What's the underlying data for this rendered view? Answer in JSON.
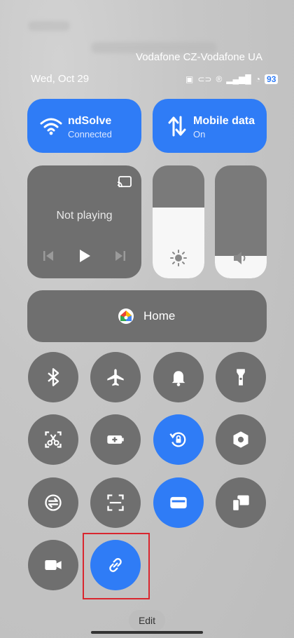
{
  "status_bar": {
    "carrier": "Vodafone CZ-Vodafone UA",
    "date": "Wed, Oct 29",
    "battery": "93"
  },
  "wifi_tile": {
    "title": "ndSolve",
    "subtitle": "Connected"
  },
  "mobile_tile": {
    "title": "Mobile data",
    "subtitle": "On"
  },
  "media": {
    "status": "Not playing"
  },
  "sliders": {
    "brightness_level": 0.63,
    "volume_level": 0.2
  },
  "home_tile": {
    "label": "Home"
  },
  "toggles": [
    {
      "icon": "bluetooth-icon",
      "active": false
    },
    {
      "icon": "airplane-icon",
      "active": false
    },
    {
      "icon": "bell-icon",
      "active": false
    },
    {
      "icon": "flashlight-icon",
      "active": false
    },
    {
      "icon": "screenshot-scissors-icon",
      "active": false
    },
    {
      "icon": "battery-saver-icon",
      "active": false
    },
    {
      "icon": "rotation-lock-icon",
      "active": true
    },
    {
      "icon": "settings-hex-icon",
      "active": false
    },
    {
      "icon": "sync-icon",
      "active": false
    },
    {
      "icon": "scan-icon",
      "active": false
    },
    {
      "icon": "wallet-card-icon",
      "active": true
    },
    {
      "icon": "cast-devices-icon",
      "active": false
    },
    {
      "icon": "video-camera-icon",
      "active": false
    },
    {
      "icon": "link-icon",
      "active": true
    }
  ],
  "edit_label": "Edit",
  "colors": {
    "active": "#2f7cf6",
    "inactive": "#6f6f6f",
    "highlight": "#d9262e"
  }
}
